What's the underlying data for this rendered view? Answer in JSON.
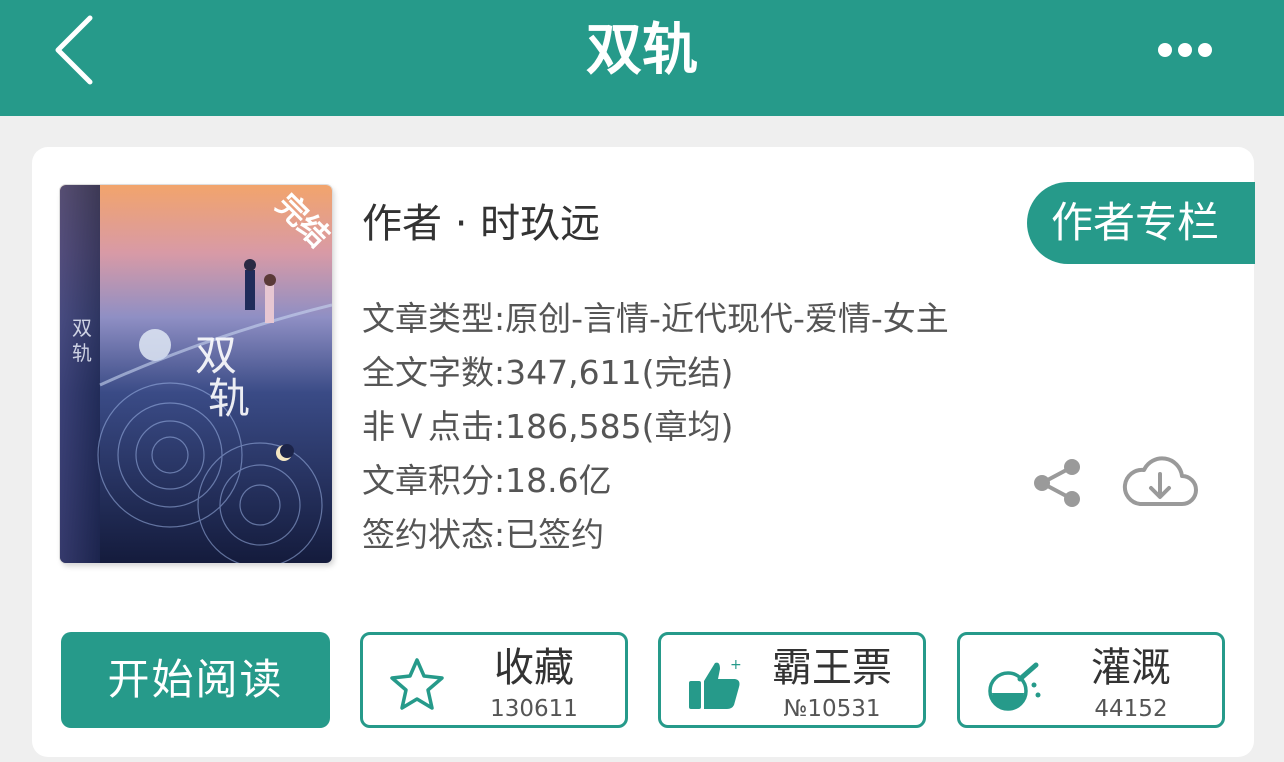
{
  "header": {
    "title": "双轨",
    "back_icon": "chevron-left-icon",
    "more_icon": "more-dots-icon"
  },
  "book": {
    "cover_badge": "完结",
    "cover_title": "双轨",
    "author_line": "作者 · 时玖远",
    "author_column_button": "作者专栏",
    "info": [
      {
        "key": "文章类型:",
        "value": "原创-言情-近代现代-爱情-女主"
      },
      {
        "key": "全文字数:",
        "value": "347,611(完结)"
      },
      {
        "key": "非Ｖ点击:",
        "value": "186,585(章均)"
      },
      {
        "key": "文章积分:",
        "value": "18.6亿"
      },
      {
        "key": "签约状态:",
        "value": "已签约"
      }
    ],
    "share_icon": "share-icon",
    "download_icon": "cloud-download-icon"
  },
  "actions": {
    "read_label": "开始阅读",
    "items": [
      {
        "label": "收藏",
        "count": "130611",
        "icon": "star-icon"
      },
      {
        "label": "霸王票",
        "count": "№10531",
        "icon": "thumbs-up-icon"
      },
      {
        "label": "灌溉",
        "count": "44152",
        "icon": "watering-flask-icon"
      }
    ]
  },
  "colors": {
    "accent": "#269a8a",
    "background": "#efefef",
    "card": "#ffffff",
    "text": "#333333",
    "icon_gray": "#9a9a9a",
    "badge": "#e8542b"
  }
}
